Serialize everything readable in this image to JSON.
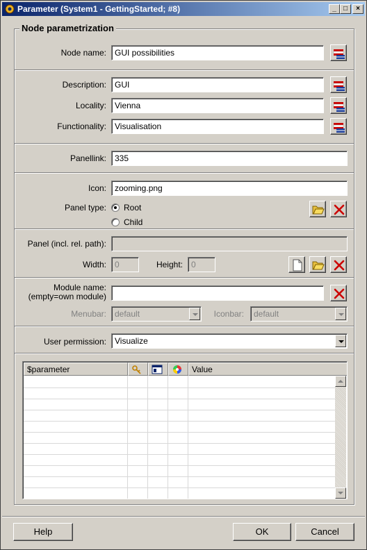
{
  "window": {
    "title": "Parameter (System1 - GettingStarted; #8)",
    "app_icon": "gear-icon",
    "minimize": "_",
    "maximize": "□",
    "close": "×"
  },
  "group": {
    "legend": "Node parametrization"
  },
  "node": {
    "label": "Node name:",
    "value": "GUI possibilities"
  },
  "description": {
    "label": "Description:",
    "value": "GUI"
  },
  "locality": {
    "label": "Locality:",
    "value": "Vienna"
  },
  "functionality": {
    "label": "Functionality:",
    "value": "Visualisation"
  },
  "panellink": {
    "label": "Panellink:",
    "value": "335"
  },
  "icon": {
    "label": "Icon:",
    "value": "zooming.png"
  },
  "panel_type": {
    "label": "Panel type:",
    "options": [
      "Root",
      "Child"
    ],
    "selected": "Root"
  },
  "panel": {
    "path_label": "Panel (incl. rel. path):",
    "path_value": "",
    "width_label": "Width:",
    "width_value": "0",
    "height_label": "Height:",
    "height_value": "0"
  },
  "module": {
    "label_line1": "Module name:",
    "label_line2": "(empty=own module)",
    "value": "",
    "menubar_label": "Menubar:",
    "menubar_value": "default",
    "iconbar_label": "Iconbar:",
    "iconbar_value": "default"
  },
  "permission": {
    "label": "User permission:",
    "value": "Visualize"
  },
  "table": {
    "columns": [
      "$parameter",
      "",
      "",
      "",
      "Value"
    ],
    "column_icons": [
      "",
      "key-icon",
      "window-icon",
      "color-wheel-icon",
      ""
    ],
    "rows": 11
  },
  "buttons": {
    "help": "Help",
    "ok": "OK",
    "cancel": "Cancel"
  },
  "colors": {
    "titlebar_start": "#0a246a",
    "titlebar_end": "#a6caf0",
    "dialog_bg": "#d4d0c8",
    "delete_red": "#cc0000"
  }
}
